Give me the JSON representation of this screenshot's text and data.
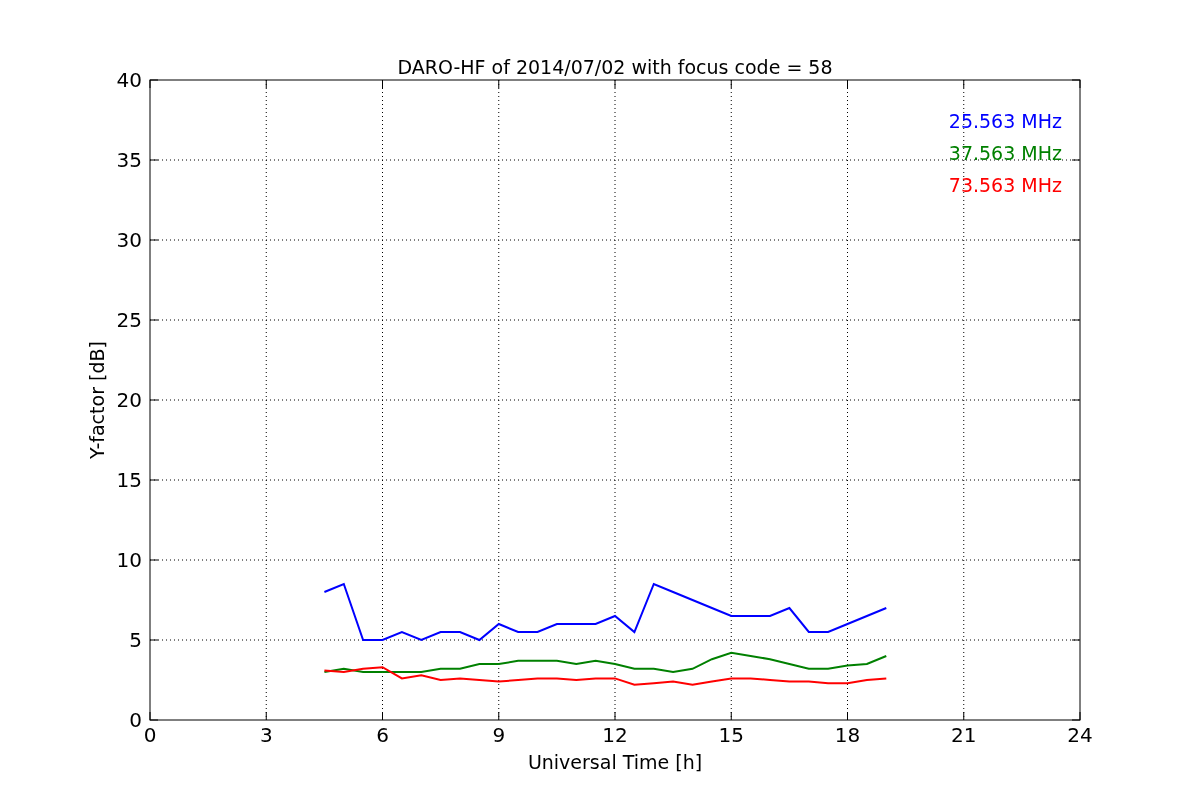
{
  "chart_data": {
    "type": "line",
    "title": "DARO-HF of 2014/07/02 with focus code = 58",
    "xlabel": "Universal Time [h]",
    "ylabel": "Y-factor [dB]",
    "x": [
      4.5,
      5,
      5.5,
      6,
      6.5,
      7,
      7.5,
      8,
      8.5,
      9,
      9.5,
      10,
      10.5,
      11,
      11.5,
      12,
      12.5,
      13,
      13.5,
      14,
      14.5,
      15,
      15.5,
      16,
      16.5,
      17,
      17.5,
      18,
      18.5,
      19
    ],
    "series": [
      {
        "name": "25.563 MHz",
        "color": "#0000ff",
        "values": [
          8.0,
          8.5,
          5.0,
          5.0,
          5.5,
          5.0,
          5.5,
          5.5,
          5.0,
          6.0,
          5.5,
          5.5,
          6.0,
          6.0,
          6.0,
          6.5,
          5.5,
          8.5,
          8.0,
          7.5,
          7.0,
          6.5,
          6.5,
          6.5,
          7.0,
          5.5,
          5.5,
          6.0,
          6.5,
          7.0
        ]
      },
      {
        "name": "37.563 MHz",
        "color": "#008000",
        "values": [
          3.0,
          3.2,
          3.0,
          3.0,
          3.0,
          3.0,
          3.2,
          3.2,
          3.5,
          3.5,
          3.7,
          3.7,
          3.7,
          3.5,
          3.7,
          3.5,
          3.2,
          3.2,
          3.0,
          3.2,
          3.8,
          4.2,
          4.0,
          3.8,
          3.5,
          3.2,
          3.2,
          3.4,
          3.5,
          4.0
        ]
      },
      {
        "name": "73.563 MHz",
        "color": "#ff0000",
        "values": [
          3.1,
          3.0,
          3.2,
          3.3,
          2.6,
          2.8,
          2.5,
          2.6,
          2.5,
          2.4,
          2.5,
          2.6,
          2.6,
          2.5,
          2.6,
          2.6,
          2.2,
          2.3,
          2.4,
          2.2,
          2.4,
          2.6,
          2.6,
          2.5,
          2.4,
          2.4,
          2.3,
          2.3,
          2.5,
          2.6
        ]
      }
    ],
    "xlim": [
      0,
      24
    ],
    "ylim": [
      0,
      40
    ],
    "xticks": [
      0,
      3,
      6,
      9,
      12,
      15,
      18,
      21,
      24
    ],
    "yticks": [
      0,
      5,
      10,
      15,
      20,
      25,
      30,
      35,
      40
    ],
    "grid": true
  }
}
